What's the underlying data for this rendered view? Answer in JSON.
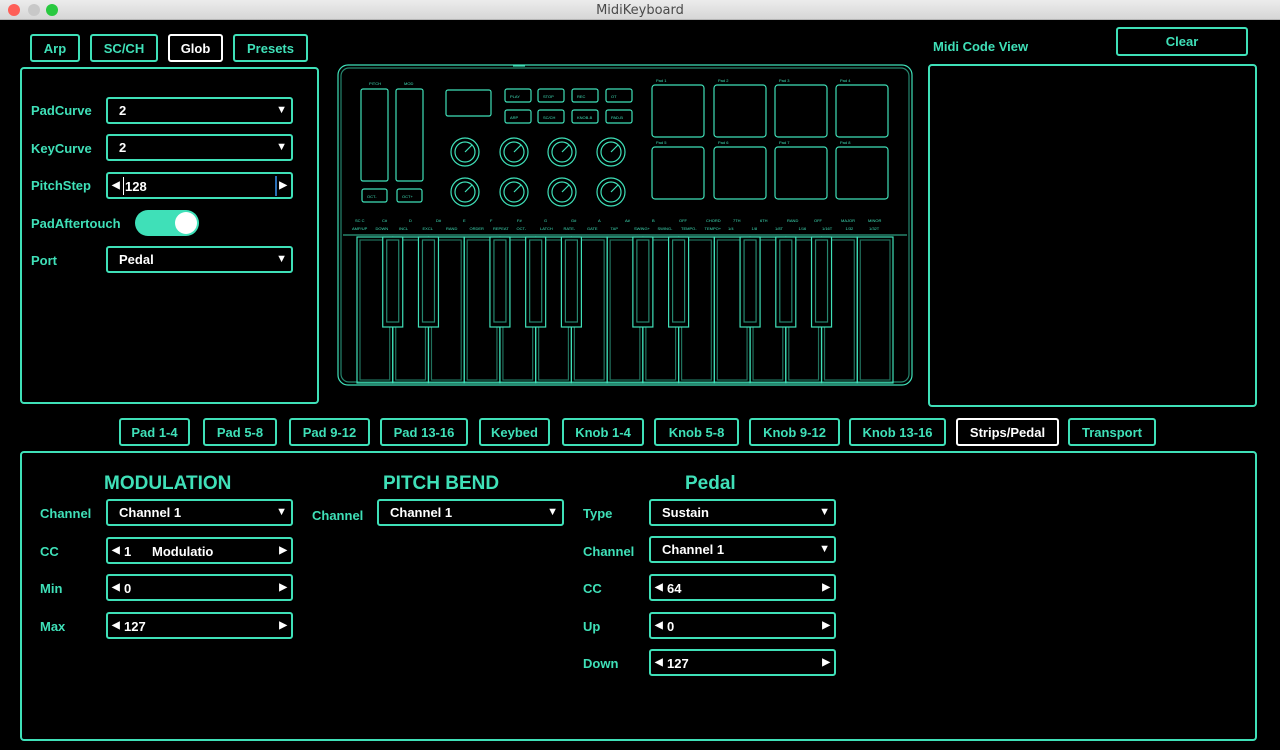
{
  "window": {
    "title": "MidiKeyboard"
  },
  "top_tabs": [
    "Arp",
    "SC/CH",
    "Glob",
    "Presets"
  ],
  "top_tabs_active": "Glob",
  "glob": {
    "pad_curve": {
      "label": "PadCurve",
      "value": "2"
    },
    "key_curve": {
      "label": "KeyCurve",
      "value": "2"
    },
    "pitch_step": {
      "label": "PitchStep",
      "value": "128"
    },
    "pad_aftertouch": {
      "label": "PadAftertouch",
      "on": true
    },
    "port": {
      "label": "Port",
      "value": "Pedal"
    }
  },
  "keyboard_graphic": {
    "strip_labels": [
      "PITCH",
      "MOD"
    ],
    "oct_buttons": [
      "OCT-",
      "OCT+"
    ],
    "transport_buttons": [
      "PLAY",
      "STOP",
      "REC",
      "OT",
      "ARP",
      "SC/CH",
      "KNOB-B",
      "PAD-B"
    ],
    "pads": [
      "Pad 1",
      "Pad 2",
      "Pad 3",
      "Pad 4",
      "Pad 5",
      "Pad 6",
      "Pad 7",
      "Pad 8"
    ],
    "key_labels_top": [
      "SC C",
      "C#",
      "D",
      "D#",
      "E",
      "F",
      "F#",
      "G",
      "G#",
      "A",
      "A#",
      "B",
      "OFF",
      "CHORD",
      "7TH",
      "6TH",
      "RAND",
      "OFF",
      "MAJOR",
      "MINOR"
    ],
    "key_labels_bottom": [
      "AMP/UP",
      "DOWN",
      "INCL",
      "EXCL",
      "RAND",
      "ORDER",
      "REPEAT",
      "OCT-",
      "LATCH",
      "RATE-",
      "GATE",
      "TAP",
      "SWING+",
      "SWING-",
      "TEMPO-",
      "TEMPO+",
      "1/4",
      "1/8",
      "1/8T",
      "1/16",
      "1/16T",
      "1/32",
      "1/32T"
    ]
  },
  "midi_code_view": {
    "title": "Midi Code View",
    "clear_label": "Clear"
  },
  "bottom_tabs": [
    "Pad 1-4",
    "Pad 5-8",
    "Pad 9-12",
    "Pad 13-16",
    "Keybed",
    "Knob 1-4",
    "Knob 5-8",
    "Knob 9-12",
    "Knob 13-16",
    "Strips/Pedal",
    "Transport"
  ],
  "bottom_tabs_active": "Strips/Pedal",
  "modulation": {
    "heading": "MODULATION",
    "channel_label": "Channel",
    "channel": "Channel 1",
    "cc_label": "CC",
    "cc_num": "1",
    "cc_name": "Modulatio",
    "min_label": "Min",
    "min": "0",
    "max_label": "Max",
    "max": "127"
  },
  "pitch_bend": {
    "heading": "PITCH BEND",
    "channel_label": "Channel",
    "channel": "Channel 1"
  },
  "pedal": {
    "heading": "Pedal",
    "type_label": "Type",
    "type": "Sustain",
    "channel_label": "Channel",
    "channel": "Channel 1",
    "cc_label": "CC",
    "cc": "64",
    "up_label": "Up",
    "up": "0",
    "down_label": "Down",
    "down": "127"
  },
  "colors": {
    "accent": "#3fe0b8",
    "background": "#000000",
    "active_border": "#ffffff"
  }
}
